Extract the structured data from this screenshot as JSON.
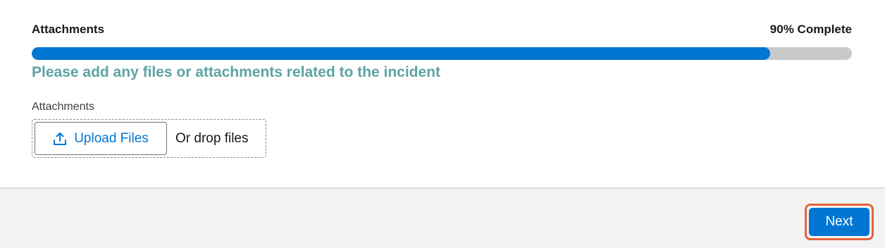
{
  "progress": {
    "step_title": "Attachments",
    "status_text": "90% Complete",
    "percent": 90
  },
  "section": {
    "heading": "Please add any files or attachments related to the incident"
  },
  "attachments_field": {
    "label": "Attachments",
    "upload_button_label": "Upload Files",
    "upload_icon": "upload-icon",
    "drop_text": "Or drop files"
  },
  "footer": {
    "next_label": "Next"
  },
  "colors": {
    "accent": "#0176d3",
    "heading": "#5ea3a3",
    "focus_ring": "#e3643b"
  }
}
